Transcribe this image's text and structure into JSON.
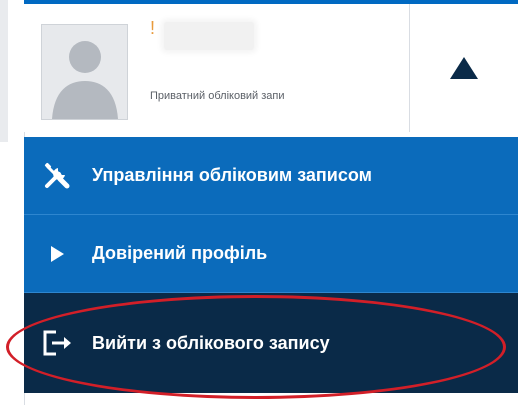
{
  "account": {
    "name_mark": "!",
    "type_label": "Приватний обліковий запи"
  },
  "menu": [
    {
      "label": "Управління обліковим записом",
      "icon": "tools-icon"
    },
    {
      "label": "Довірений профіль",
      "icon": "play-arrow-icon"
    },
    {
      "label": "Вийти з облікового запису",
      "icon": "sign-out-icon"
    }
  ],
  "icons": {
    "toggle": "triangle-up-icon",
    "avatar": "user-silhouette-icon"
  },
  "colors": {
    "menu_blue": "#0b6bbb",
    "menu_dark": "#0a2a48",
    "highlight": "#d21f28"
  }
}
